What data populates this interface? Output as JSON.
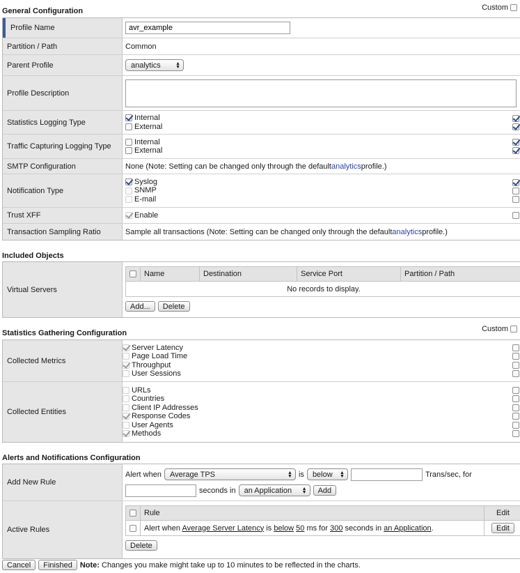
{
  "general": {
    "title": "General Configuration",
    "custom_label": "Custom",
    "profile_name_label": "Profile Name",
    "profile_name_value": "avr_example",
    "partition_label": "Partition / Path",
    "partition_value": "Common",
    "parent_label": "Parent Profile",
    "parent_value": "analytics",
    "description_label": "Profile Description",
    "stats_logging_label": "Statistics Logging Type",
    "stats_internal": "Internal",
    "stats_external": "External",
    "traffic_label": "Traffic Capturing Logging Type",
    "traffic_internal": "Internal",
    "traffic_external": "External",
    "smtp_label": "SMTP Configuration",
    "smtp_text": "None (Note: Setting can be changed only through the default",
    "smtp_link": "analytics",
    "smtp_suffix": "profile.)",
    "notification_label": "Notification Type",
    "notif_syslog": "Syslog",
    "notif_snmp": "SNMP",
    "notif_email": "E-mail",
    "trust_label": "Trust XFF",
    "trust_enable": "Enable",
    "sampling_label": "Transaction Sampling Ratio",
    "sampling_text": "Sample all transactions (Note: Setting can be changed only through the default",
    "sampling_link": "analytics",
    "sampling_suffix": "profile.)"
  },
  "included": {
    "title": "Included Objects",
    "vs_label": "Virtual Servers",
    "columns": [
      "Name",
      "Destination",
      "Service Port",
      "Partition / Path"
    ],
    "empty_text": "No records to display.",
    "add_button": "Add...",
    "delete_button": "Delete"
  },
  "stats": {
    "title": "Statistics Gathering Configuration",
    "custom_label": "Custom",
    "metrics_label": "Collected Metrics",
    "metrics": [
      {
        "label": "Server Latency",
        "checked": true
      },
      {
        "label": "Page Load Time",
        "checked": false
      },
      {
        "label": "Throughput",
        "checked": true
      },
      {
        "label": "User Sessions",
        "checked": false
      }
    ],
    "entities_label": "Collected Entities",
    "entities": [
      {
        "label": "URLs",
        "checked": false
      },
      {
        "label": "Countries",
        "checked": false
      },
      {
        "label": "Client IP Addresses",
        "checked": false
      },
      {
        "label": "Response Codes",
        "checked": true
      },
      {
        "label": "User Agents",
        "checked": false
      },
      {
        "label": "Methods",
        "checked": true
      }
    ]
  },
  "alerts": {
    "title": "Alerts and Notifications Configuration",
    "add_rule_label": "Add New Rule",
    "alert_when": "Alert when",
    "metric_value": "Average TPS",
    "is_text": "is",
    "direction_value": "below",
    "trans_text": "Trans/sec, for",
    "seconds_in": "seconds in",
    "scope_value": "an Application",
    "add_button": "Add",
    "active_label": "Active Rules",
    "rule_header": "Rule",
    "edit_header": "Edit",
    "rule": {
      "prefix": "Alert when",
      "metric": "Average Server Latency",
      "is": "is",
      "direction": "below",
      "value": "50",
      "unit": "ms for",
      "seconds": "300",
      "seconds_in": "seconds in",
      "scope": "an Application",
      "end": "."
    },
    "edit_button": "Edit",
    "delete_button": "Delete"
  },
  "footer": {
    "cancel": "Cancel",
    "finished": "Finished",
    "note_label": "Note:",
    "note_text": "Changes you make might take up to 10 minutes to be reflected in the charts."
  }
}
